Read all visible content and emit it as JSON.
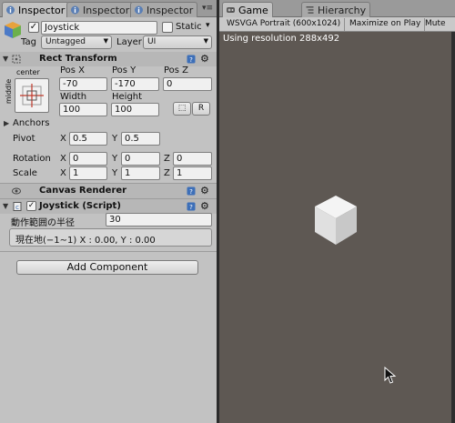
{
  "inspector_tabs": [
    "Inspector",
    "Inspector",
    "Inspector"
  ],
  "game_tabs": [
    "Game",
    "Hierarchy"
  ],
  "object": {
    "enabled": true,
    "name": "Joystick",
    "static_label": "Static",
    "static_checked": false,
    "tag_label": "Tag",
    "tag_value": "Untagged",
    "layer_label": "Layer",
    "layer_value": "UI"
  },
  "rect_transform": {
    "title": "Rect Transform",
    "anchor_top_label": "center",
    "anchor_side_label": "middle",
    "posx_label": "Pos X",
    "posx": "-70",
    "posy_label": "Pos Y",
    "posy": "-170",
    "posz_label": "Pos Z",
    "posz": "0",
    "width_label": "Width",
    "width": "100",
    "height_label": "Height",
    "height": "100",
    "r_button": "R",
    "anchors_label": "Anchors",
    "pivot_label": "Pivot",
    "pivot_x": "0.5",
    "pivot_y": "0.5",
    "rotation_label": "Rotation",
    "rot_x": "0",
    "rot_y": "0",
    "rot_z": "0",
    "scale_label": "Scale",
    "scale_x": "1",
    "scale_y": "1",
    "scale_z": "1",
    "x": "X",
    "y": "Y",
    "z": "Z"
  },
  "canvas_renderer": {
    "title": "Canvas Renderer"
  },
  "joystick_script": {
    "title": "Joystick (Script)",
    "radius_label": "動作範囲の半径",
    "radius_value": "30",
    "status_text": "現在地(−1∼1)  X : 0.00,  Y : 0.00"
  },
  "add_component": "Add Component",
  "game_view": {
    "aspect": "WSVGA Portrait (600x1024)",
    "maximize": "Maximize on Play",
    "mute": "Mute",
    "resolution_text": "Using resolution 288x492"
  }
}
